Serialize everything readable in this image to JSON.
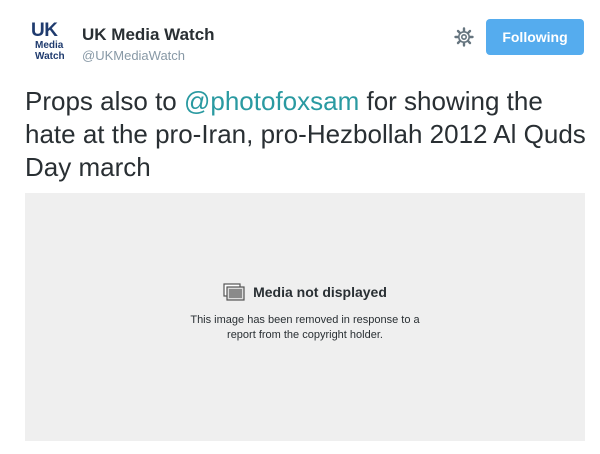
{
  "account": {
    "avatar_lines": [
      "UK",
      "Media",
      "Watch"
    ],
    "display_name": "UK Media Watch",
    "screen_name": "@UKMediaWatch"
  },
  "actions": {
    "gear_icon": "gear-icon",
    "follow_label": "Following"
  },
  "tweet": {
    "text_before": "Props also to ",
    "mention": "@photofoxsam",
    "text_after": " for showing the hate at the pro-Iran, pro-Hezbollah 2012 Al Quds Day march"
  },
  "media": {
    "title": "Media not displayed",
    "line1": "This image has been removed in response to a",
    "line2": "report from the copyright holder."
  },
  "colors": {
    "follow_button": "#55acee",
    "mention": "#2a9aa1",
    "media_background": "#efefef"
  }
}
